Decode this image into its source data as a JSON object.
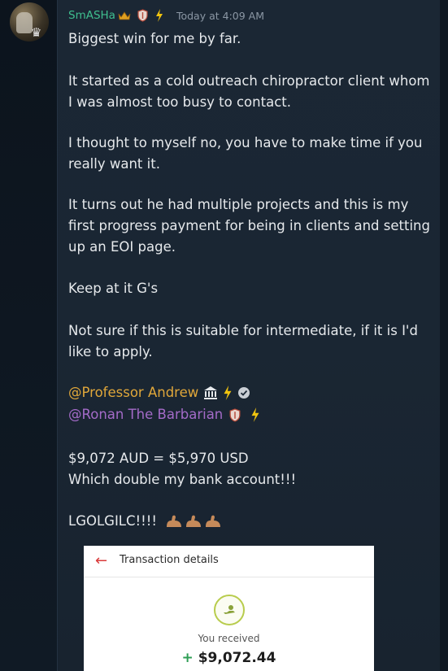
{
  "author": {
    "name": "SmASHa",
    "timestamp": "Today at 4:09 AM"
  },
  "message": {
    "p1": "Biggest win for me by far.",
    "p2": "It started as a cold outreach chiropractor client whom I was almost too busy to contact.",
    "p3": "I thought to myself no, you have to make time if you really want it.",
    "p4": "It turns out he had multiple projects and this is my first progress payment for being in clients and setting up an EOI page.",
    "p5": "Keep at it G's",
    "p6": "Not sure if this is suitable for intermediate, if it is I'd like to apply.",
    "mention1": "@Professor Andrew",
    "mention2": "@Ronan The Barbarian",
    "p7a": "$9,072 AUD = $5,970 USD",
    "p7b": "Which double my bank account!!!",
    "p8": "LGOLGILC!!!!"
  },
  "transaction": {
    "title": "Transaction details",
    "received_label": "You received",
    "plus": "+",
    "amount": "$9,072.44"
  },
  "colors": {
    "username": "#3fbf8f",
    "mention_professor": "#e0a73a",
    "mention_ronan": "#a46bc8",
    "accent_red": "#d93a3a"
  }
}
